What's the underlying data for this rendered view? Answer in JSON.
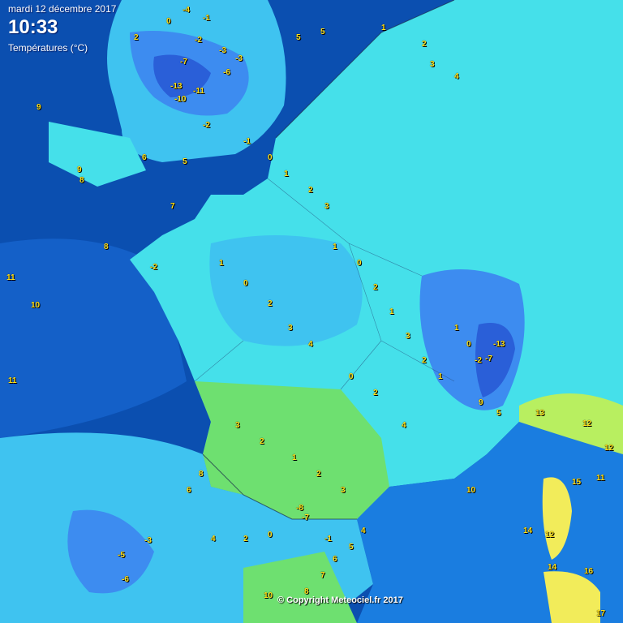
{
  "header": {
    "date": "mardi 12 décembre 2017",
    "time": "10:33",
    "variable": "Températures (°C)"
  },
  "copyright": "© Copyright Meteociel.fr 2017",
  "colors": {
    "sea_deep": "#0b4fb0",
    "sea": "#1a7de0",
    "cold_2": "#2a5fd8",
    "cold_1": "#3d8cf0",
    "mild_0": "#3fc3f0",
    "mild_2": "#45e0ea",
    "warm_4": "#5fe8a8",
    "warm_6": "#6ee070",
    "warm_10": "#b8ef60",
    "warm_14": "#f2ec5a",
    "label": "#ffe11a"
  },
  "legend_note": "",
  "stations": [
    {
      "v": "-4"
    },
    {
      "v": "-1"
    },
    {
      "v": "0"
    },
    {
      "v": "2"
    },
    {
      "v": "5"
    },
    {
      "v": "5"
    },
    {
      "v": "1"
    },
    {
      "v": "2"
    },
    {
      "v": "3"
    },
    {
      "v": "4"
    },
    {
      "v": "-2"
    },
    {
      "v": "-3"
    },
    {
      "v": "-7"
    },
    {
      "v": "-13"
    },
    {
      "v": "-11"
    },
    {
      "v": "-10"
    },
    {
      "v": "-6"
    },
    {
      "v": "-3"
    },
    {
      "v": "-2"
    },
    {
      "v": "-1"
    },
    {
      "v": "0"
    },
    {
      "v": "1"
    },
    {
      "v": "2"
    },
    {
      "v": "3"
    },
    {
      "v": "6"
    },
    {
      "v": "9"
    },
    {
      "v": "5"
    },
    {
      "v": "8"
    },
    {
      "v": "7"
    },
    {
      "v": "8"
    },
    {
      "v": "9"
    },
    {
      "v": "11"
    },
    {
      "v": "10"
    },
    {
      "v": "11"
    },
    {
      "v": "-2"
    },
    {
      "v": "1"
    },
    {
      "v": "0"
    },
    {
      "v": "2"
    },
    {
      "v": "3"
    },
    {
      "v": "4"
    },
    {
      "v": "1"
    },
    {
      "v": "0"
    },
    {
      "v": "2"
    },
    {
      "v": "1"
    },
    {
      "v": "3"
    },
    {
      "v": "2"
    },
    {
      "v": "1"
    },
    {
      "v": "0"
    },
    {
      "v": "2"
    },
    {
      "v": "4"
    },
    {
      "v": "3"
    },
    {
      "v": "2"
    },
    {
      "v": "1"
    },
    {
      "v": "2"
    },
    {
      "v": "3"
    },
    {
      "v": "1"
    },
    {
      "v": "0"
    },
    {
      "v": "-2"
    },
    {
      "v": "-7"
    },
    {
      "v": "-13"
    },
    {
      "v": "9"
    },
    {
      "v": "5"
    },
    {
      "v": "13"
    },
    {
      "v": "12"
    },
    {
      "v": "12"
    },
    {
      "v": "14"
    },
    {
      "v": "12"
    },
    {
      "v": "14"
    },
    {
      "v": "16"
    },
    {
      "v": "15"
    },
    {
      "v": "17"
    },
    {
      "v": "10"
    },
    {
      "v": "8"
    },
    {
      "v": "7"
    },
    {
      "v": "6"
    },
    {
      "v": "5"
    },
    {
      "v": "4"
    },
    {
      "v": "-8"
    },
    {
      "v": "-7"
    },
    {
      "v": "-5"
    },
    {
      "v": "-6"
    },
    {
      "v": "-3"
    },
    {
      "v": "-1"
    },
    {
      "v": "0"
    },
    {
      "v": "2"
    },
    {
      "v": "4"
    },
    {
      "v": "6"
    },
    {
      "v": "8"
    },
    {
      "v": "10"
    },
    {
      "v": "11"
    }
  ]
}
